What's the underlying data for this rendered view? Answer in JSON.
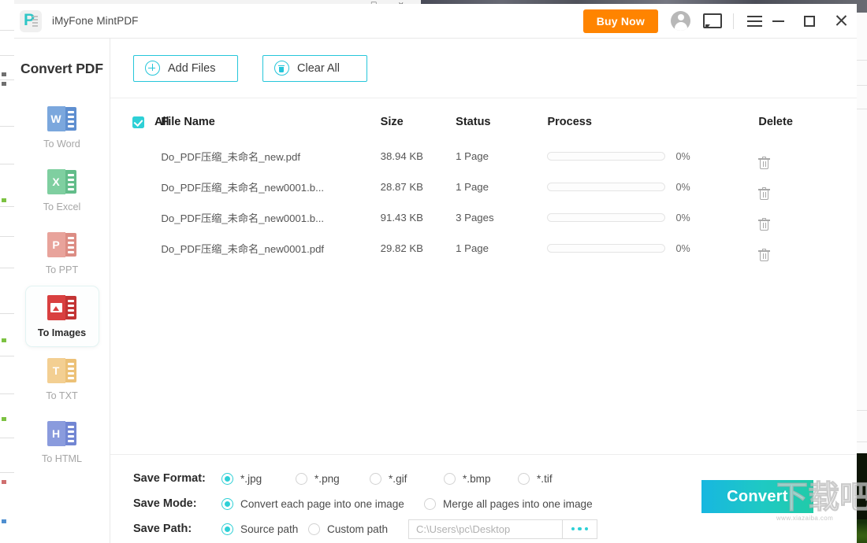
{
  "window": {
    "app_title": "iMyFone MintPDF",
    "logo_letter": "P",
    "buy_now_label": "Buy Now",
    "icons": {
      "avatar": "account-avatar-icon",
      "chat": "feedback-chat-icon",
      "menu": "hamburger-menu-icon",
      "minimize": "minimize-icon",
      "maximize": "maximize-icon",
      "close": "close-icon"
    }
  },
  "sidebar": {
    "title": "Convert PDF",
    "items": [
      {
        "label": "To Word",
        "letter": "W",
        "color": "#7ba7dd",
        "color_dark": "#5f8fd0",
        "active": false,
        "icon": "to-word-icon"
      },
      {
        "label": "To Excel",
        "letter": "X",
        "color": "#7fcfa0",
        "color_dark": "#63bd8a",
        "active": false,
        "icon": "to-excel-icon"
      },
      {
        "label": "To PPT",
        "letter": "P",
        "color": "#e8a39b",
        "color_dark": "#dc8d84",
        "active": false,
        "icon": "to-ppt-icon"
      },
      {
        "label": "To Images",
        "letter": "",
        "color": "#d94040",
        "color_dark": "#c33434",
        "active": true,
        "icon": "to-images-icon"
      },
      {
        "label": "To TXT",
        "letter": "T",
        "color": "#f3cf92",
        "color_dark": "#ecc177",
        "active": false,
        "icon": "to-txt-icon"
      },
      {
        "label": "To HTML",
        "letter": "H",
        "color": "#8a9bdd",
        "color_dark": "#7286d3",
        "active": false,
        "icon": "to-html-icon"
      }
    ]
  },
  "toolbar": {
    "add_files_label": "Add Files",
    "clear_all_label": "Clear All"
  },
  "file_table": {
    "headers": {
      "all": "All",
      "file_name": "File Name",
      "size": "Size",
      "status": "Status",
      "process": "Process",
      "delete": "Delete"
    },
    "rows": [
      {
        "checked": true,
        "name": "Do_PDF压缩_未命名_new.pdf",
        "size": "38.94 KB",
        "status": "1 Page",
        "progress": 0,
        "percent": "0%"
      },
      {
        "checked": true,
        "name": "Do_PDF压缩_未命名_new0001.b...",
        "size": "28.87 KB",
        "status": "1 Page",
        "progress": 0,
        "percent": "0%"
      },
      {
        "checked": true,
        "name": "Do_PDF压缩_未命名_new0001.b...",
        "size": "91.43 KB",
        "status": "3 Pages",
        "progress": 0,
        "percent": "0%"
      },
      {
        "checked": true,
        "name": "Do_PDF压缩_未命名_new0001.pdf",
        "size": "29.82 KB",
        "status": "1 Page",
        "progress": 0,
        "percent": "0%"
      }
    ]
  },
  "settings": {
    "save_format": {
      "label": "Save Format:",
      "options": [
        {
          "label": "*.jpg",
          "selected": true
        },
        {
          "label": "*.png",
          "selected": false
        },
        {
          "label": "*.gif",
          "selected": false
        },
        {
          "label": "*.bmp",
          "selected": false
        },
        {
          "label": "*.tif",
          "selected": false
        }
      ]
    },
    "save_mode": {
      "label": "Save Mode:",
      "options": [
        {
          "label": "Convert each page into one image",
          "selected": true
        },
        {
          "label": "Merge all pages into one image",
          "selected": false
        }
      ]
    },
    "save_path": {
      "label": "Save Path:",
      "options": [
        {
          "label": "Source path",
          "selected": true
        },
        {
          "label": "Custom path",
          "selected": false
        }
      ],
      "path_placeholder": "C:\\Users\\pc\\Desktop",
      "browse_icon": "ellipsis-browse-icon"
    },
    "convert_label": "Convert"
  },
  "watermark": {
    "text": "下载吧",
    "site": "www.xiazaiba.com"
  },
  "colors": {
    "accent": "#2ed0d6",
    "accent_border": "#26c6da",
    "buy_now": "#ff8400",
    "convert_from": "#17b7e0",
    "convert_to": "#20cba8",
    "active_red": "#d94040"
  }
}
